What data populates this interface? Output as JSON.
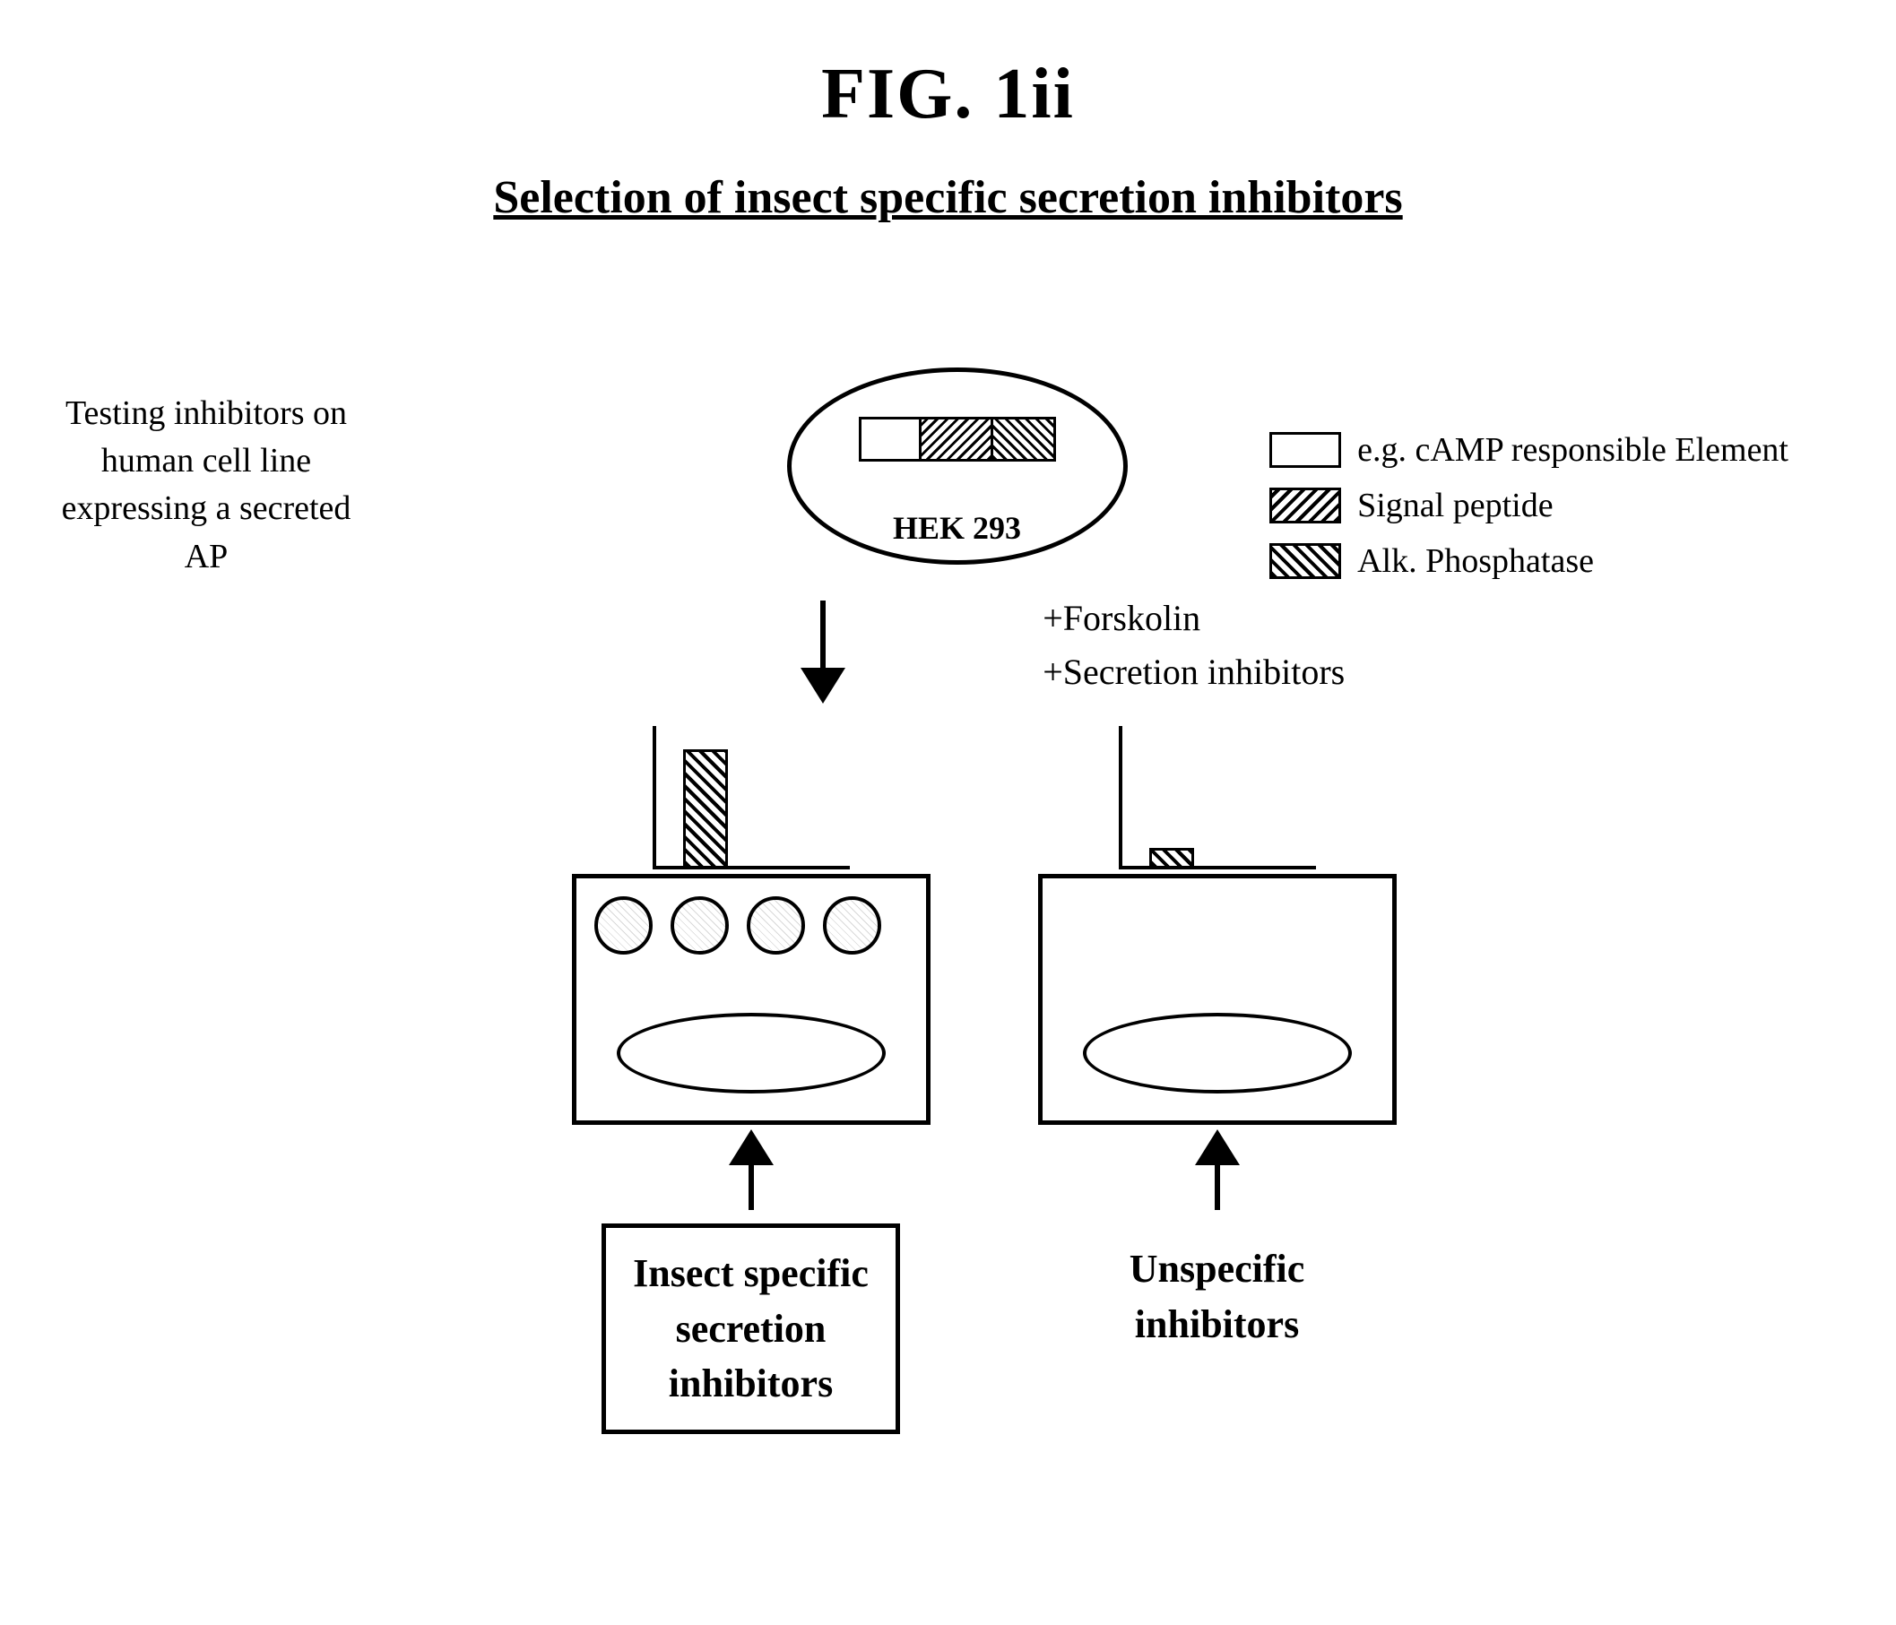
{
  "title": "FIG. 1ii",
  "subtitle": "Selection of insect specific secretion inhibitors",
  "legend": {
    "items": [
      {
        "label": "e.g. cAMP responsible Element",
        "type": "plain"
      },
      {
        "label": "Signal peptide",
        "type": "signal"
      },
      {
        "label": "Alk. Phosphatase",
        "type": "alk"
      }
    ]
  },
  "hek_label": "HEK 293",
  "testing_text": "Testing inhibitors on\nhuman cell line\nexpressing a secreted AP",
  "forskolin_text": "+Forskolin\n+Secretion inhibitors",
  "left_label": "Insect specific\nsecretion\ninhibitors",
  "right_label": "Unspecific\ninhibitors"
}
